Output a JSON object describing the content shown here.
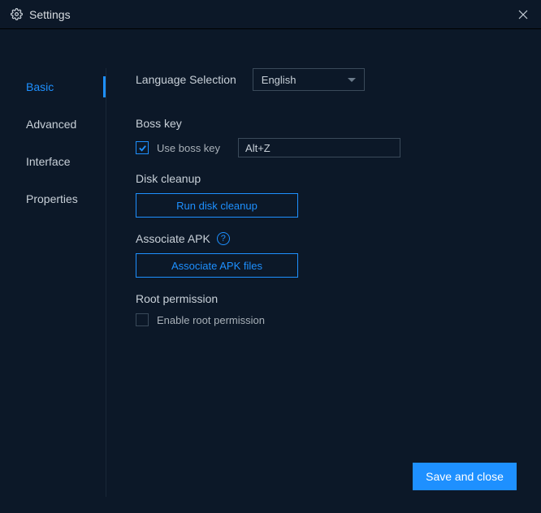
{
  "titlebar": {
    "title": "Settings"
  },
  "sidebar": {
    "items": [
      {
        "label": "Basic",
        "active": true
      },
      {
        "label": "Advanced",
        "active": false
      },
      {
        "label": "Interface",
        "active": false
      },
      {
        "label": "Properties",
        "active": false
      }
    ]
  },
  "main": {
    "language": {
      "label": "Language Selection",
      "value": "English"
    },
    "bosskey": {
      "header": "Boss key",
      "checkbox_label": "Use boss key",
      "checked": true,
      "shortcut": "Alt+Z"
    },
    "disk": {
      "header": "Disk cleanup",
      "button": "Run disk cleanup"
    },
    "apk": {
      "header": "Associate APK",
      "help": "?",
      "button": "Associate APK files"
    },
    "root": {
      "header": "Root permission",
      "checkbox_label": "Enable root permission",
      "checked": false
    }
  },
  "footer": {
    "save": "Save and close"
  }
}
